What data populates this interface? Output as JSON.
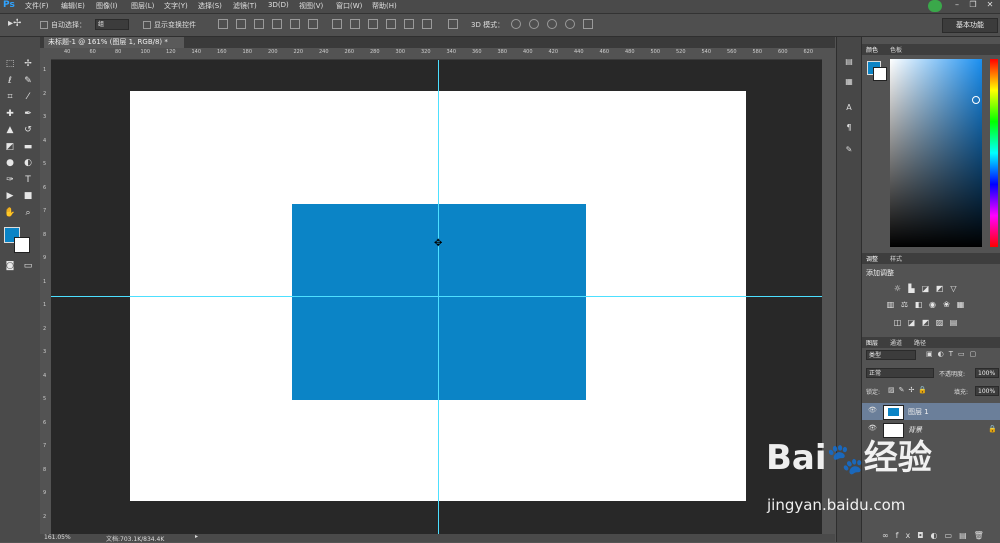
{
  "app": {
    "logo": "Ps"
  },
  "menu": [
    "文件(F)",
    "编辑(E)",
    "图像(I)",
    "图层(L)",
    "文字(Y)",
    "选择(S)",
    "滤镜(T)",
    "3D(D)",
    "视图(V)",
    "窗口(W)",
    "帮助(H)"
  ],
  "options": {
    "auto_select": "自动选择：",
    "auto_select_value": "组",
    "show_transform": "显示变换控件",
    "mode3d": "3D 模式：",
    "workspace": "基本功能"
  },
  "document": {
    "tab": "未标题-1 @ 161% (图层 1, RGB/8) *"
  },
  "ruler_h": [
    "40",
    "60",
    "80",
    "100",
    "120",
    "140",
    "160",
    "180",
    "200",
    "220",
    "240",
    "260",
    "280",
    "300",
    "320",
    "340",
    "360",
    "380",
    "400",
    "420",
    "440",
    "460",
    "480",
    "500",
    "520",
    "540",
    "560",
    "580",
    "600",
    "620"
  ],
  "ruler_v": [
    "1",
    "2",
    "3",
    "4",
    "5",
    "6",
    "7",
    "8",
    "9",
    "1",
    "1",
    "2",
    "3",
    "4",
    "5",
    "6",
    "7",
    "8",
    "9",
    "2"
  ],
  "canvas": {
    "background": "#ffffff",
    "rect_color": "#0b84c6",
    "guide_color": "#4de0ff"
  },
  "status": {
    "zoom": "161.05%",
    "doc": "文档:703.1K/834.4K"
  },
  "panels": {
    "color_tabs": [
      "颜色",
      "色板"
    ],
    "adjust_tabs": [
      "调整",
      "样式"
    ],
    "adjust_title": "添加调整",
    "layers_tabs": [
      "图层",
      "通道",
      "路径"
    ],
    "kind": "类型",
    "blend": "正常",
    "opacity_label": "不透明度:",
    "opacity_value": "100%",
    "lock_label": "锁定:",
    "fill_label": "填充:",
    "fill_value": "100%",
    "layers": [
      {
        "name": "图层 1",
        "selected": true
      },
      {
        "name": "背景",
        "selected": false
      }
    ]
  },
  "watermark": {
    "brand": "Bai",
    "paw": "du",
    "cn": "经验",
    "url": "jingyan.baidu.com"
  }
}
